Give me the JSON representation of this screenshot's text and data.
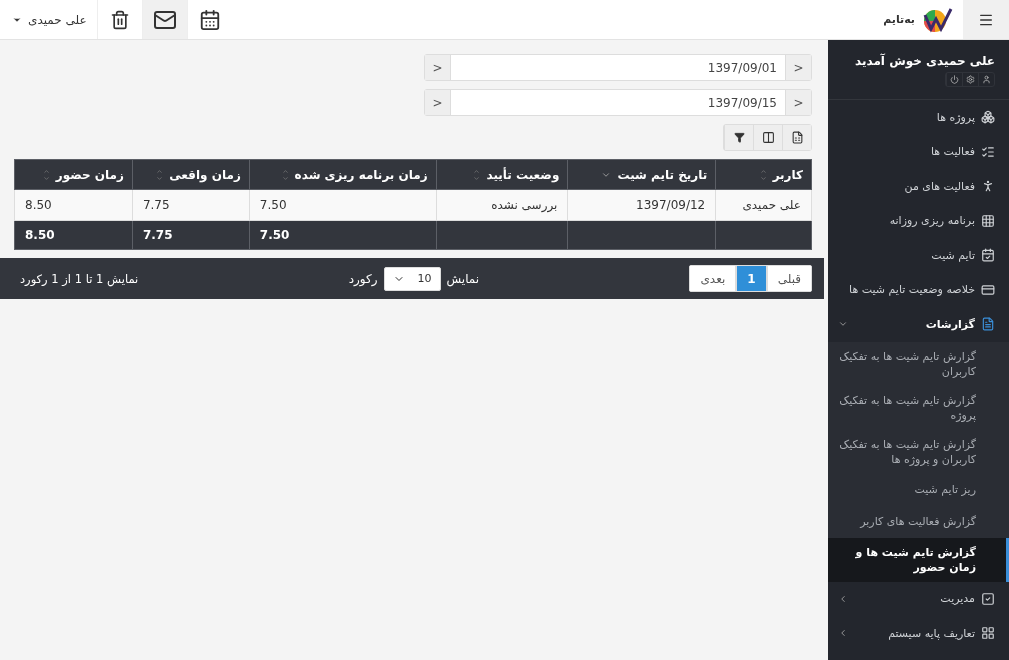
{
  "topbar": {
    "logo_text": "به‌تایم",
    "user_menu": "علی حمیدی"
  },
  "sidebar": {
    "welcome": "علی حمیدی خوش آمدید",
    "items": [
      {
        "kind": "projects",
        "label": "پروژه ها"
      },
      {
        "kind": "activities",
        "label": "فعالیت ها"
      },
      {
        "kind": "my-activities",
        "label": "فعالیت های من"
      },
      {
        "kind": "daily-plan",
        "label": "برنامه ریزی روزانه"
      },
      {
        "kind": "timesheet",
        "label": "تایم شیت"
      },
      {
        "kind": "summary",
        "label": "خلاصه وضعیت تایم شیت ها"
      },
      {
        "kind": "reports",
        "label": "گزارشات",
        "expanded": true,
        "children": [
          {
            "label": "گزارش تایم شیت ها به تفکیک کاربران",
            "selected": false
          },
          {
            "label": "گزارش تایم شیت ها به تفکیک پروژه",
            "selected": false
          },
          {
            "label": "گزارش تایم شیت ها به تفکیک کاربران و پروژه ها",
            "selected": false
          },
          {
            "label": "ریز تایم شیت",
            "selected": false
          },
          {
            "label": "گزارش فعالیت های کاربر",
            "selected": false
          },
          {
            "label": "گزارش تایم شیت ها و زمان حضور",
            "selected": true
          }
        ]
      },
      {
        "kind": "management",
        "label": "مدیریت",
        "expanded": false
      },
      {
        "kind": "settings",
        "label": "تعاریف پایه سیستم",
        "expanded": false
      }
    ]
  },
  "filters": [
    {
      "value": "1397/09/01",
      "prev": "<",
      "next": "<"
    },
    {
      "value": "1397/09/15",
      "prev": "<",
      "next": "<"
    }
  ],
  "table": {
    "columns": [
      {
        "label": "کاربر",
        "sorted": false
      },
      {
        "label": "تاریخ تایم شیت",
        "sorted": true
      },
      {
        "label": "وضعیت تأیید",
        "sorted": false
      },
      {
        "label": "زمان برنامه ریزی شده",
        "sorted": false
      },
      {
        "label": "زمان واقعی",
        "sorted": false
      },
      {
        "label": "زمان حضور",
        "sorted": false
      }
    ],
    "rows": [
      [
        "علی حمیدی",
        "1397/09/12",
        "بررسی نشده",
        "7.50",
        "7.75",
        "8.50"
      ]
    ],
    "totals": {
      "planned_time": "7.50",
      "actual_time": "7.75",
      "attendance_time": "8.50"
    }
  },
  "pager": {
    "previous": "قبلی",
    "pages": [
      {
        "label": "1",
        "selected": true
      }
    ],
    "next": "بعدی",
    "show_label": "نمایش",
    "page_size": "10",
    "records_label": "رکورد",
    "info": "نمایش 1 تا 1 از 1 رکورد"
  }
}
